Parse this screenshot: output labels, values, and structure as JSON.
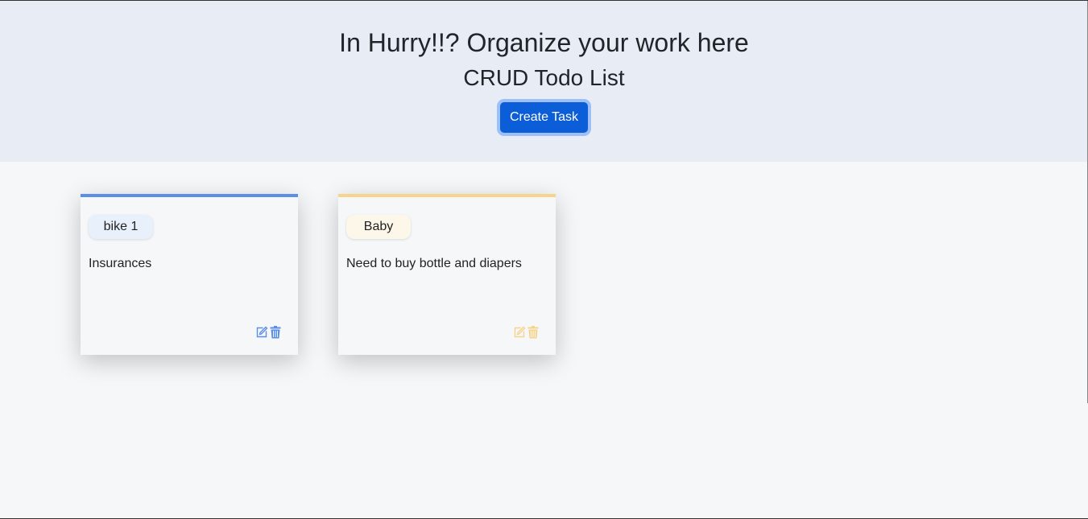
{
  "header": {
    "title": "In Hurry!!? Organize your work here",
    "subtitle": "CRUD Todo List",
    "create_label": "Create Task"
  },
  "cards": [
    {
      "tag": "bike 1",
      "description": "Insurances",
      "accent": "#5b8ee6",
      "tag_bg": "#e8f0fc",
      "icons": [
        "edit-icon",
        "trash-icon"
      ]
    },
    {
      "tag": "Baby",
      "description": "Need to buy bottle and diapers",
      "accent": "#f6d48b",
      "tag_bg": "#fdf7ea",
      "icons": [
        "edit-icon",
        "trash-icon"
      ]
    }
  ]
}
